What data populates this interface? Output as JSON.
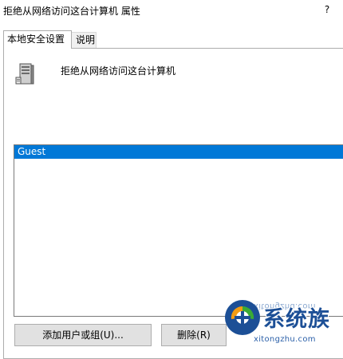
{
  "window": {
    "title": "拒绝从网络访问这台计算机 属性",
    "help_label": "?"
  },
  "tabs": [
    {
      "label": "本地安全设置",
      "active": true
    },
    {
      "label": "说明",
      "active": false
    }
  ],
  "policy": {
    "name": "拒绝从网络访问这台计算机",
    "icon": "server-computer-icon"
  },
  "accounts": [
    {
      "label": "Guest",
      "selected": true
    }
  ],
  "buttons": {
    "add_label": "添加用户或组(U)...",
    "remove_label": "删除(R)"
  },
  "watermark": {
    "brand": "系统族",
    "url": "xitongzhu.com",
    "mirror_url": "xitongzhu.com",
    "colors": {
      "blue": "#1c4f96",
      "orange": "#f39c12",
      "green": "#3aaa35"
    }
  },
  "colors": {
    "selection": "#0078d7",
    "button_bg": "#e1e1e1",
    "border": "#adadad"
  }
}
